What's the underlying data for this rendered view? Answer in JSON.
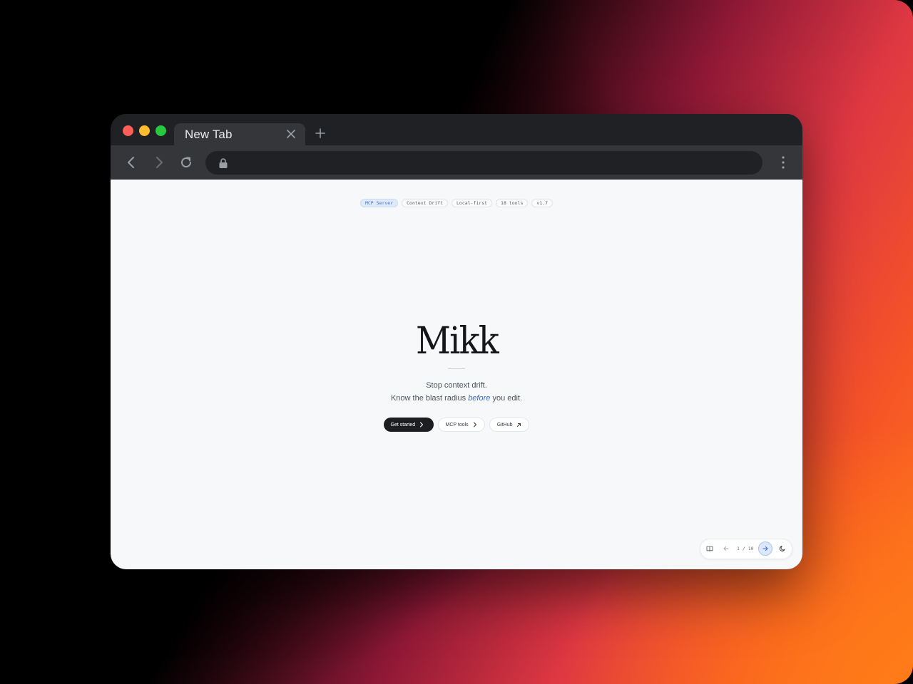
{
  "browser": {
    "tab": {
      "title": "New Tab"
    },
    "toolbar": {
      "address_value": ""
    }
  },
  "page": {
    "badges": [
      {
        "label": "MCP Server",
        "active": true
      },
      {
        "label": "Context Drift",
        "active": false
      },
      {
        "label": "Local-first",
        "active": false
      },
      {
        "label": "18 tools",
        "active": false
      },
      {
        "label": "v1.7",
        "active": false
      }
    ],
    "hero": {
      "title": "Mikk",
      "line1": "Stop context drift.",
      "line2_before": "Know the blast radius ",
      "line2_emphasis": "before",
      "line2_after": " you edit."
    },
    "cta": {
      "primary_label": "Get started",
      "secondary_label": "MCP tools",
      "github_label": "GitHub"
    },
    "slide_nav": {
      "current": "1",
      "separator": "/",
      "total": "10"
    }
  },
  "icons": {
    "tab_close": "close-icon",
    "new_tab": "plus-icon",
    "back": "arrow-left-icon",
    "forward": "arrow-right-icon",
    "reload": "reload-icon",
    "lock": "lock-icon",
    "menu": "kebab-menu-icon",
    "present": "book-icon",
    "theme": "moon-icon"
  },
  "colors": {
    "accent": "#3f6db9",
    "primary_button": "#1c1e22",
    "badge_active_bg": "#dfeafb"
  }
}
